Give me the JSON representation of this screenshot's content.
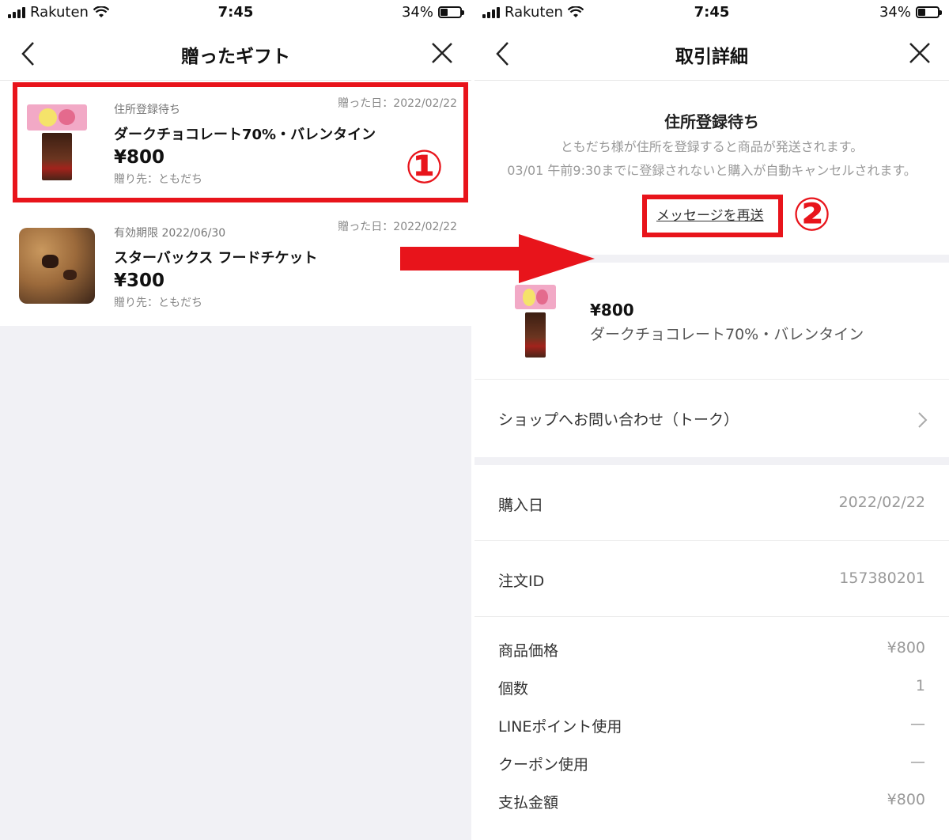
{
  "status_bar": {
    "carrier": "Rakuten",
    "time": "7:45",
    "battery": "34%",
    "battery_level": 0.34
  },
  "left_screen": {
    "title": "贈ったギフト",
    "gifts": [
      {
        "status": "住所登録待ち",
        "date": "贈った日：2022/02/22",
        "name": "ダークチョコレート70%・バレンタイン",
        "price": "¥800",
        "recipient": "贈り先：ともだち",
        "image": "chocolate-gift-image"
      },
      {
        "status": "有効期限 2022/06/30",
        "date": "贈った日：2022/02/22",
        "name": "スターバックス フードチケット",
        "price": "¥300",
        "recipient": "贈り先：ともだち",
        "image": "cookie-image"
      }
    ],
    "callout": "①"
  },
  "right_screen": {
    "title": "取引詳細",
    "status_title": "住所登録待ち",
    "status_desc": "ともだち様が住所を登録すると商品が発送されます。",
    "status_note": "03/01 午前9:30までに登録されないと購入が自動キャンセルされます。",
    "resend_label": "メッセージを再送",
    "callout": "②",
    "product": {
      "price": "¥800",
      "name": "ダークチョコレート70%・バレンタイン"
    },
    "shop_contact": "ショップへお問い合わせ（トーク）",
    "purchase_date": {
      "label": "購入日",
      "value": "2022/02/22"
    },
    "order_id": {
      "label": "注文ID",
      "value": "157380201"
    },
    "details": [
      {
        "label": "商品価格",
        "value": "¥800"
      },
      {
        "label": "個数",
        "value": "1"
      },
      {
        "label": "LINEポイント使用",
        "value": "—"
      },
      {
        "label": "クーポン使用",
        "value": "—"
      },
      {
        "label": "支払金額",
        "value": "¥800"
      }
    ]
  },
  "colors": {
    "highlight": "#e8141b",
    "arrow": "#e8141b",
    "background_gray": "#f1f1f5"
  }
}
